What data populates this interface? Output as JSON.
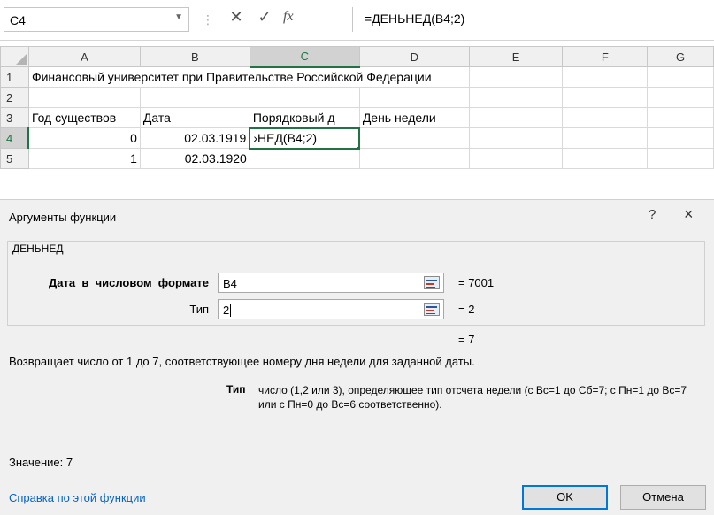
{
  "formula_bar": {
    "name_box": "C4",
    "cancel_glyph": "✕",
    "enter_glyph": "✓",
    "fx_label": "fx",
    "formula": "=ДЕНЬНЕД(B4;2)"
  },
  "grid": {
    "columns": [
      "A",
      "B",
      "C",
      "D",
      "E",
      "F",
      "G"
    ],
    "rows": [
      {
        "num": "1",
        "A": "Финансовый университет при Правительстве Российской Федерации",
        "B": "",
        "C": "",
        "D": ""
      },
      {
        "num": "2",
        "A": "",
        "B": "",
        "C": "",
        "D": ""
      },
      {
        "num": "3",
        "A": "Год существов",
        "B": "Дата",
        "C": "Порядковый д",
        "D": "День недели"
      },
      {
        "num": "4",
        "A": "0",
        "B": "02.03.1919",
        "C": "›НЕД(B4;2)",
        "D": ""
      },
      {
        "num": "5",
        "A": "1",
        "B": "02.03.1920",
        "C": "",
        "D": ""
      }
    ]
  },
  "dialog": {
    "title": "Аргументы функции",
    "help_glyph": "?",
    "close_glyph": "×",
    "function_name": "ДЕНЬНЕД",
    "args": [
      {
        "label": "Дата_в_числовом_формате",
        "value": "B4",
        "result": "=  7001"
      },
      {
        "label": "Тип",
        "value": "2",
        "result": "=  2"
      }
    ],
    "formula_result": "=  7",
    "description": "Возвращает число от 1 до 7, соответствующее номеру дня недели для заданной даты.",
    "arg_desc_name": "Тип",
    "arg_desc_text": "число (1,2 или 3), определяющее тип отсчета недели (с Вс=1 до Сб=7; с Пн=1 до Вс=7 или с Пн=0 до Вс=6 соответственно).",
    "value_label": "Значение:  7",
    "help_link": "Справка по этой функции",
    "ok_label": "OK",
    "cancel_label": "Отмена"
  },
  "colors": {
    "excel_green": "#217346",
    "link_blue": "#0563c1",
    "dialog_bg": "#f0f0f0"
  }
}
